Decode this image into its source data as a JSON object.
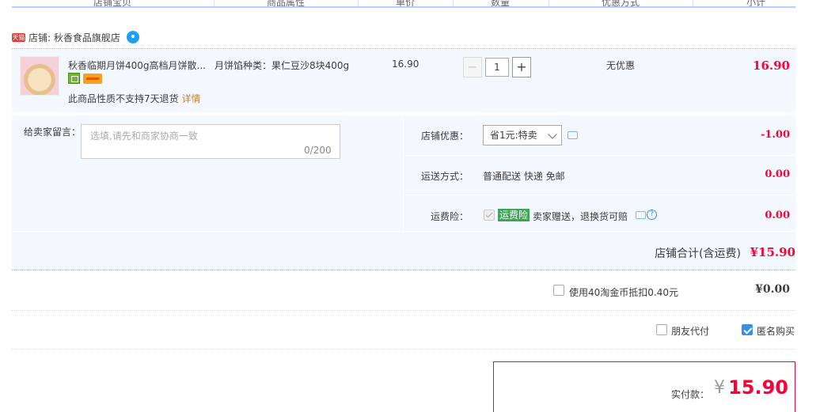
{
  "header": {
    "columns": [
      "店铺宝贝",
      "商品属性",
      "单价",
      "数量",
      "优惠方式",
      "小计"
    ]
  },
  "shop": {
    "badge": "天猫",
    "label": "店铺: 秋香食品旗舰店"
  },
  "item": {
    "name": "秋香临期月饼400g高档月饼散...",
    "return_note": "此商品性质不支持7天退货",
    "details_link": "详情",
    "property": "月饼馅种类：果仁豆沙8块400g",
    "unit_price": "16.90",
    "quantity": "1",
    "minus": "−",
    "plus": "+",
    "discount": "无优惠",
    "subtotal": "16.90"
  },
  "message": {
    "label": "给卖家留言：",
    "placeholder": "选填,请先和商家协商一致",
    "count": "0/200"
  },
  "shop_discount": {
    "label": "店铺优惠：",
    "selected": "省1元:特卖",
    "value": "-1.00"
  },
  "shipping": {
    "label": "运送方式：",
    "method": "普通配送 快递 免邮",
    "value": "0.00"
  },
  "insurance": {
    "label": "运费险：",
    "badge": "运费险",
    "text": "卖家赠送，退换货可赔",
    "help": "?",
    "value": "0.00"
  },
  "shop_total": {
    "label": "店铺合计(含运费)",
    "value": "¥15.90"
  },
  "coins": {
    "label": "使用40淘金币抵扣0.40元",
    "value": "¥0.00"
  },
  "options": {
    "friend_pay": "朋友代付",
    "anonymous": "匿名购买"
  },
  "payment": {
    "label": "实付款：",
    "currency": "¥",
    "value": "15.90"
  },
  "colors": {
    "price_red": "#ff0036",
    "panel_bg": "#f3f8fe",
    "accent_blue": "#3a8ee6"
  }
}
